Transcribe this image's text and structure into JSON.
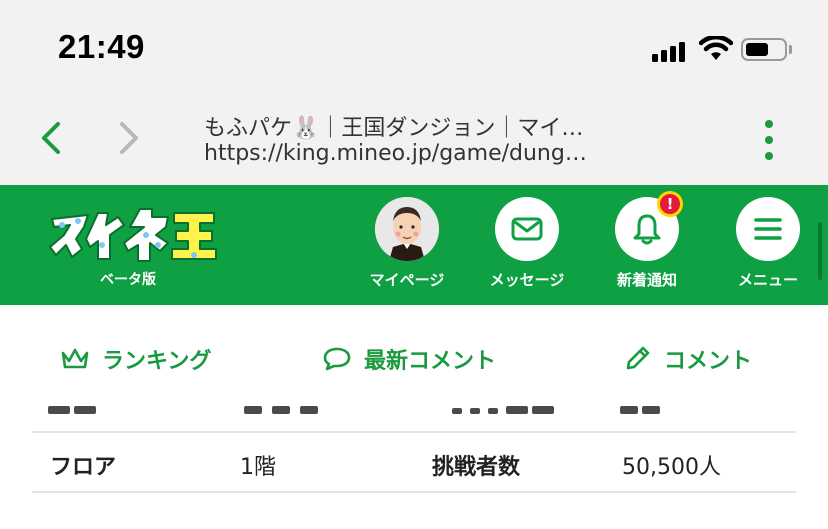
{
  "status": {
    "time": "21:49"
  },
  "browser": {
    "title": "もふパケ🐰｜王国ダンジョン｜マイ…",
    "url": "https://king.mineo.jp/game/dung…"
  },
  "header": {
    "beta_label": "ベータ版",
    "items": [
      {
        "label": "マイページ",
        "icon": "avatar"
      },
      {
        "label": "メッセージ",
        "icon": "envelope-icon"
      },
      {
        "label": "新着通知",
        "icon": "bell-icon",
        "badge": "!"
      },
      {
        "label": "メニュー",
        "icon": "hamburger-icon"
      }
    ]
  },
  "tabs": [
    {
      "label": "ランキング",
      "icon": "crown-icon"
    },
    {
      "label": "最新コメント",
      "icon": "speech-bubble-icon"
    },
    {
      "label": "コメント",
      "icon": "pencil-icon"
    }
  ],
  "table": {
    "row": {
      "c1": "フロア",
      "c2": "1階",
      "c3": "挑戦者数",
      "c4": "50,500人"
    }
  },
  "colors": {
    "brand_green": "#0ea043",
    "accent_green": "#1a9a3f",
    "badge_red": "#e21b3b"
  }
}
